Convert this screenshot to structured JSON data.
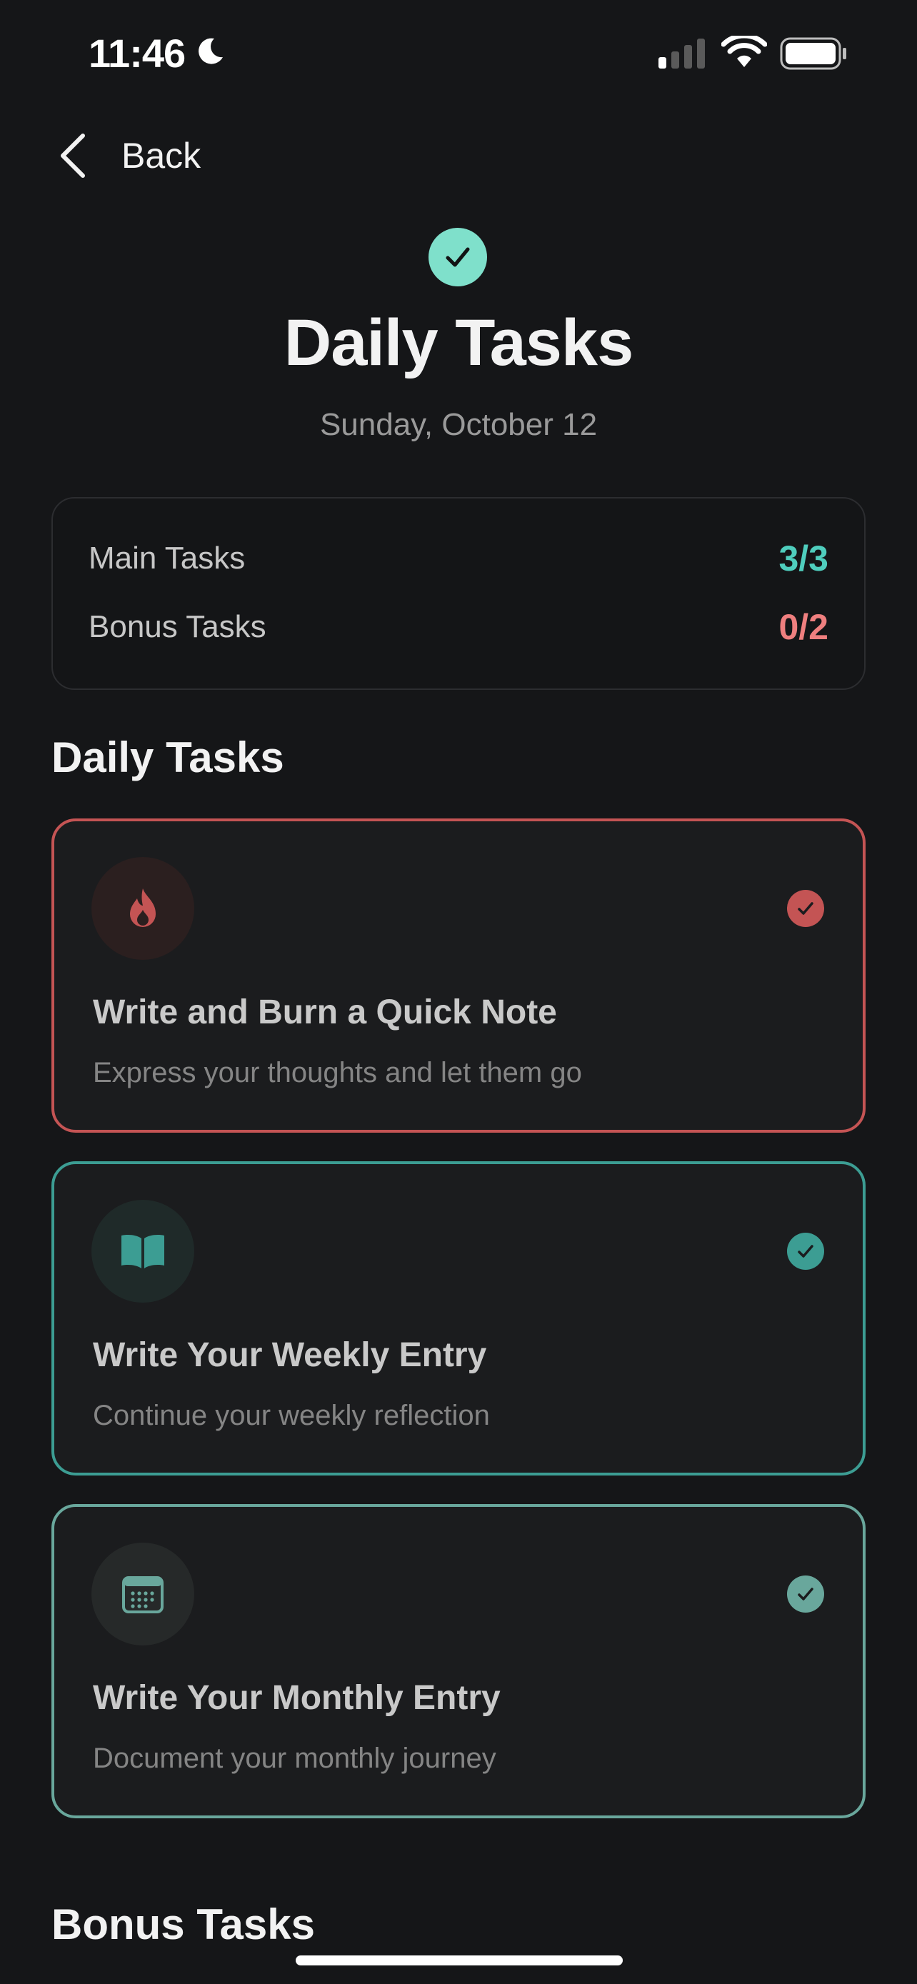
{
  "status_bar": {
    "time": "11:46",
    "icons": [
      "moon-icon",
      "cellular-signal-icon",
      "wifi-icon",
      "battery-icon"
    ]
  },
  "nav": {
    "back_label": "Back"
  },
  "header": {
    "title": "Daily Tasks",
    "date": "Sunday, October 12"
  },
  "summary": {
    "main_label": "Main Tasks",
    "main_value": "3/3",
    "bonus_label": "Bonus Tasks",
    "bonus_value": "0/2"
  },
  "sections": {
    "daily_title": "Daily Tasks",
    "bonus_title": "Bonus Tasks"
  },
  "tasks": [
    {
      "title": "Write and Burn a Quick Note",
      "description": "Express your thoughts and let them go",
      "icon": "flame-icon",
      "color": "#c45454",
      "completed": true
    },
    {
      "title": "Write Your Weekly Entry",
      "description": "Continue your weekly reflection",
      "icon": "open-book-icon",
      "color": "#3c9d93",
      "completed": true
    },
    {
      "title": "Write Your Monthly Entry",
      "description": "Document your monthly journey",
      "icon": "calendar-icon",
      "color": "#69a79c",
      "completed": true
    }
  ],
  "colors": {
    "background": "#151618",
    "accent_teal": "#4fcdbd",
    "accent_red": "#ef7f7f",
    "header_check": "#7fe0cb"
  }
}
